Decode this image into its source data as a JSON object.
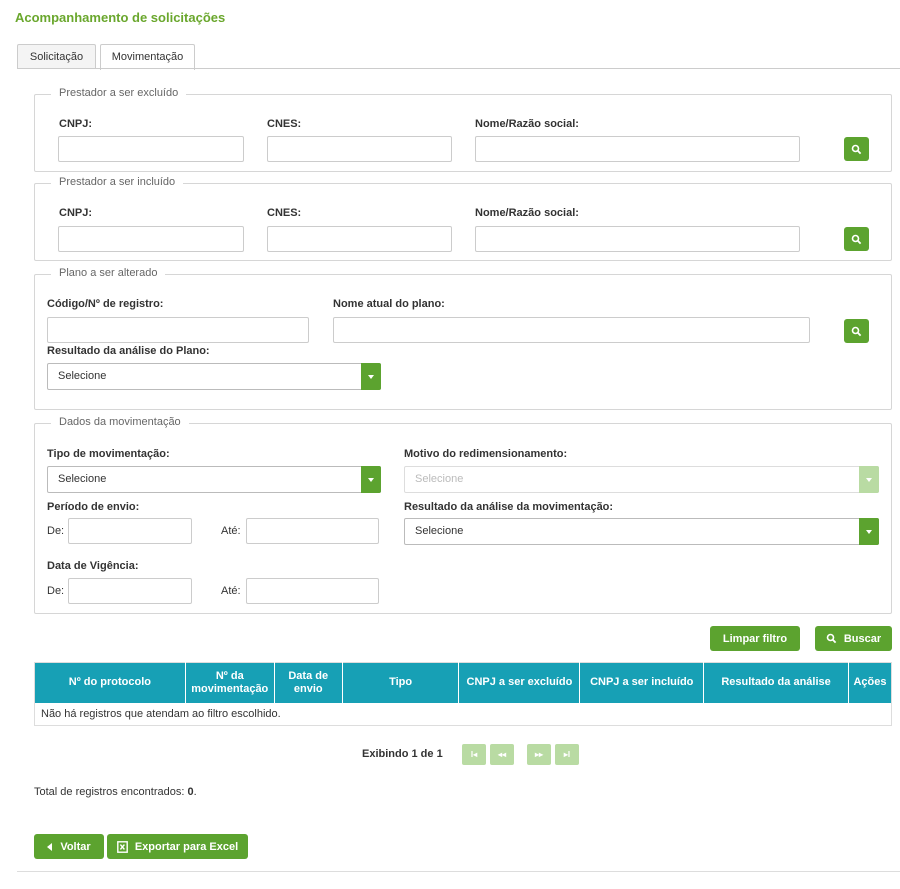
{
  "page": {
    "title": "Acompanhamento de solicitações"
  },
  "tabs": [
    {
      "label": "Solicitação"
    },
    {
      "label": "Movimentação"
    }
  ],
  "prestador_excluido": {
    "legend": "Prestador a ser excluído",
    "cnpj_label": "CNPJ:",
    "cnes_label": "CNES:",
    "nome_label": "Nome/Razão social:",
    "cnpj_value": "",
    "cnes_value": "",
    "nome_value": ""
  },
  "prestador_incluido": {
    "legend": "Prestador a ser incluído",
    "cnpj_label": "CNPJ:",
    "cnes_label": "CNES:",
    "nome_label": "Nome/Razão social:",
    "cnpj_value": "",
    "cnes_value": "",
    "nome_value": ""
  },
  "plano": {
    "legend": "Plano a ser alterado",
    "codigo_label": "Código/Nº de registro:",
    "nome_label": "Nome atual do plano:",
    "resultado_label": "Resultado da análise do Plano:",
    "resultado_value": "Selecione",
    "codigo_value": "",
    "nome_value": ""
  },
  "movimentacao": {
    "legend": "Dados da movimentação",
    "tipo_label": "Tipo de movimentação:",
    "tipo_value": "Selecione",
    "motivo_label": "Motivo do redimensionamento:",
    "motivo_value": "Selecione",
    "periodo_label": "Período de envio:",
    "de_label": "De:",
    "ate_label": "Até:",
    "resultado_label": "Resultado da análise da movimentação:",
    "resultado_value": "Selecione",
    "vigencia_label": "Data de Vigência:",
    "vig_de_label": "De:",
    "vig_ate_label": "Até:"
  },
  "actions": {
    "limpar": "Limpar filtro",
    "buscar": "Buscar"
  },
  "table": {
    "columns": [
      "Nº do protocolo",
      "Nº da movimentação",
      "Data de envio",
      "Tipo",
      "CNPJ a ser excluído",
      "CNPJ a ser incluído",
      "Resultado da análise",
      "Ações"
    ],
    "empty_message": "Não há registros que atendam ao filtro escolhido."
  },
  "pagination": {
    "label": "Exibindo 1 de 1",
    "first": "I◂",
    "prev": "◂◂",
    "next": "▸▸",
    "last": "▸I"
  },
  "total": {
    "label": "Total de registros encontrados:",
    "value": "0",
    "suffix": "."
  },
  "footer": {
    "voltar": "Voltar",
    "exportar": "Exportar para Excel"
  },
  "colors": {
    "green": "#5ca32f",
    "title_green": "#6aa72d",
    "teal": "#17a0b5",
    "disabled_green": "#b9dba3"
  }
}
